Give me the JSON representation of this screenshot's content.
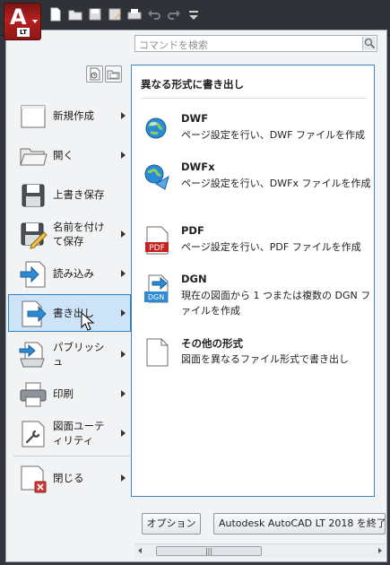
{
  "app": {
    "button_letter": "A",
    "edition": "LT"
  },
  "quick_access": {
    "icons": [
      "new-icon",
      "open-icon",
      "save-icon",
      "save-as-icon",
      "plot-icon",
      "undo-icon",
      "redo-icon",
      "customize-icon"
    ]
  },
  "search": {
    "placeholder": "コマンドを検索"
  },
  "menu": {
    "items": [
      {
        "label": "新規作成",
        "icon": "new-document-icon",
        "has_submenu": true
      },
      {
        "label": "開く",
        "icon": "folder-open-icon",
        "has_submenu": true
      },
      {
        "label": "上書き保存",
        "icon": "floppy-disk-icon",
        "has_submenu": false
      },
      {
        "label": "名前を付けて保存",
        "icon": "save-as-pencil-icon",
        "has_submenu": true
      },
      {
        "label": "読み込み",
        "icon": "import-icon",
        "has_submenu": true
      },
      {
        "label": "書き出し",
        "icon": "export-icon",
        "has_submenu": true,
        "active": true
      },
      {
        "label": "パブリッシュ",
        "icon": "publish-icon",
        "has_submenu": true
      },
      {
        "label": "印刷",
        "icon": "printer-icon",
        "has_submenu": true
      },
      {
        "label": "図面ユーティリティ",
        "icon": "drawing-utilities-icon",
        "has_submenu": true
      },
      {
        "label": "閉じる",
        "icon": "close-document-icon",
        "has_submenu": true
      }
    ]
  },
  "submenu": {
    "title": "異なる形式に書き出し",
    "entries": [
      {
        "title": "DWF",
        "desc": "ページ設定を行い、DWF ファイルを作成",
        "icon": "dwf-globe-icon"
      },
      {
        "title": "DWFx",
        "desc": "ページ設定を行い、DWFx ファイルを作成",
        "icon": "dwfx-globe-icon"
      },
      {
        "title": "PDF",
        "desc": "ページ設定を行い、PDF ファイルを作成",
        "icon": "pdf-icon"
      },
      {
        "title": "DGN",
        "desc": "現在の図面から 1 つまたは複数の DGN ファイルを作成",
        "icon": "dgn-icon"
      },
      {
        "title": "その他の形式",
        "desc": "図面を異なるファイル形式で書き出し",
        "icon": "blank-document-icon"
      }
    ]
  },
  "footer": {
    "options_label": "オプション",
    "exit_label": "Autodesk AutoCAD LT 2018 を終了"
  },
  "colors": {
    "accent": "#2f84c9",
    "app_red": "#b61f1f",
    "active_bg": "#cde3f7"
  }
}
